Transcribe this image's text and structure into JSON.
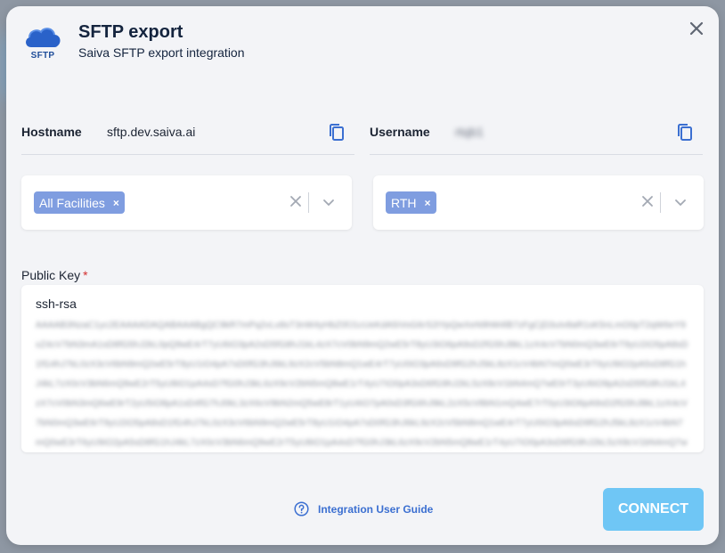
{
  "header": {
    "logo_text": "SFTP",
    "title": "SFTP export",
    "subtitle": "Saiva SFTP export integration",
    "close_icon": "close-icon"
  },
  "credentials": {
    "hostname_label": "Hostname",
    "hostname_value": "sftp.dev.saiva.ai",
    "username_label": "Username",
    "username_value": "rtqb1",
    "copy_icon": "copy-icon"
  },
  "facilities_select": {
    "chip_label": "All Facilities",
    "chip_remove": "×"
  },
  "org_select": {
    "chip_label": "RTH",
    "chip_remove": "×"
  },
  "public_key": {
    "label": "Public Key",
    "required_marker": "*",
    "prefix": "ssh-rsa",
    "value": "AAAAB3NzaC1yc2EAAAADAQABAAABgQC9kR7mPq2vLx8sT3nW4yHbZ0fJ1cUeKdA5iVoG6rS2tYpQwXeN9hM4lB7zFgCjD3uIv8aR1sK5nLmO0pT2qW6eY9xZ4cV7bN3mA1sD8fG5hJ2kL0pQ9wE4rT7yU6iO3pA2sD5fG8hJ1kL4zX7cV0bN9mQ2wE5rT8yU3iO6pA9sD2fG5hJ8kL1zX4cV7bN0mQ3wE6rT9yU2iO5pA8sD1fG4hJ7kL0zX3cV6bN9mQ2wE5rT8yU1iO4pA7sD0fG3hJ6kL9zX2cV5bN8mQ1wE4rT7yU0iO3pA6sD9fG2hJ5kL8zX1cV4bN7mQ0wE3rT6yU9iO2pA5sD8fG1hJ4kL7zX0cV3bN6mQ9wE2rT5yU8iO1pA4sD7fG0hJ3kL6zX9cV2bN5mQ8wE1rT4yU7iO0pA3sD6fG9hJ2kL5zX8cV1bN4mQ7wE0rT3yU6iO9pA2sD5fG8hJ1kL4zX7cV0bN3mQ6wE9rT2yU5iO8pA1sD4fG7hJ0kL3zX6cV9bN2mQ5wE8rT1yU4iO7pA0sD3fG6hJ9kL2zX5cV8bN1mQ4wE7rT0yU3iO6pA9sD2fG5hJ8kL1zX4cV7bN0mQ3wE6rT9yU2iO5pA8sD1fG4hJ7kL0zX3cV6bN9mQ2wE5rT8yU1iO4pA7sD0fG3hJ6kL9zX2cV5bN8mQ1wE4rT7yU0iO3pA6sD9fG2hJ5kL8zX1cV4bN7mQ0wE3rT6yU9iO2pA5sD8fG1hJ4kL7zX0cV3bN6mQ9wE2rT5yU8iO1pA4sD7fG0hJ3kL6zX9cV2bN5mQ8wE1rT4yU7iO0pA3sD6fG9hJ2kL5zX8cV1bN4mQ7wE0rT3yU6iO9pA2sD5fG8hJ1kL4zX7cV0bN3mQ6wE9rT2yU5iO8pA1sD4fG7hJ0kL3zX6 user@host.local"
  },
  "footer": {
    "guide_icon": "help-circle-icon",
    "guide_label": "Integration User Guide",
    "connect_label": "CONNECT"
  },
  "colors": {
    "chip": "#7f9de0",
    "connect": "#6fc6f5",
    "link": "#3b6fd1",
    "required": "#d32f2f"
  }
}
